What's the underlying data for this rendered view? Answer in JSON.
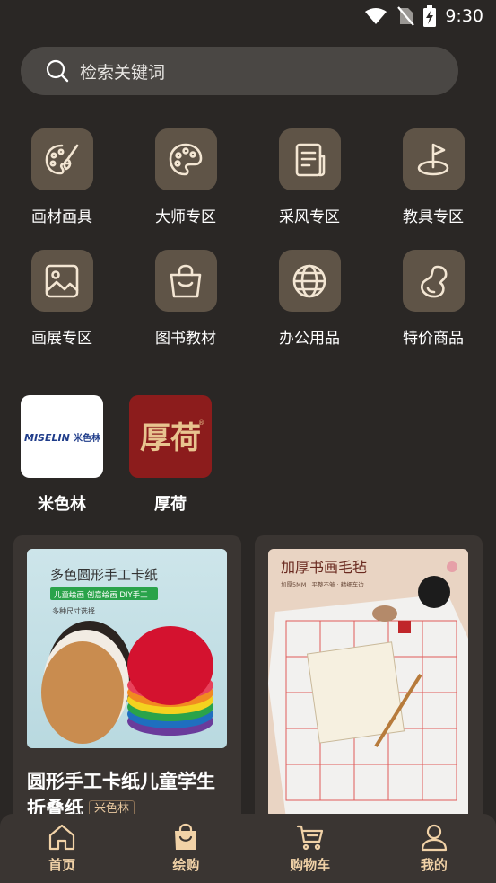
{
  "status_bar": {
    "time": "9:30"
  },
  "search": {
    "placeholder": "检索关键词"
  },
  "categories": [
    {
      "label": "画材画具",
      "icon": "palette-brush-icon"
    },
    {
      "label": "大师专区",
      "icon": "palette-icon"
    },
    {
      "label": "采风专区",
      "icon": "document-icon"
    },
    {
      "label": "教具专区",
      "icon": "flag-target-icon"
    },
    {
      "label": "画展专区",
      "icon": "image-icon"
    },
    {
      "label": "图书教材",
      "icon": "bag-icon"
    },
    {
      "label": "办公用品",
      "icon": "globe-icon"
    },
    {
      "label": "特价商品",
      "icon": "gourd-icon"
    }
  ],
  "brands": [
    {
      "name": "米色林",
      "logo_text": "MISELIN 米色林"
    },
    {
      "name": "厚荷",
      "logo_text": "厚荷"
    }
  ],
  "products": [
    {
      "title": "圆形手工卡纸儿童学生折叠纸",
      "tag": "米色林",
      "image_title": "多色圆形手工卡纸",
      "image_subtitle": "儿童绘画 创意绘画 DIY手工",
      "image_note": "多种尺寸选择"
    },
    {
      "image_title": "加厚书画毛毡",
      "image_note": "加厚5MM · 平整不皱 · 精细车边"
    }
  ],
  "tabbar": [
    {
      "label": "首页",
      "icon": "home-icon"
    },
    {
      "label": "绘购",
      "icon": "shopping-bag-icon",
      "active": true
    },
    {
      "label": "购物车",
      "icon": "cart-icon"
    },
    {
      "label": "我的",
      "icon": "user-icon"
    }
  ],
  "colors": {
    "background": "#2a2725",
    "icon_tile": "#5f5447",
    "accent": "#f1d2a7",
    "brand_red": "#8c1c1c"
  }
}
